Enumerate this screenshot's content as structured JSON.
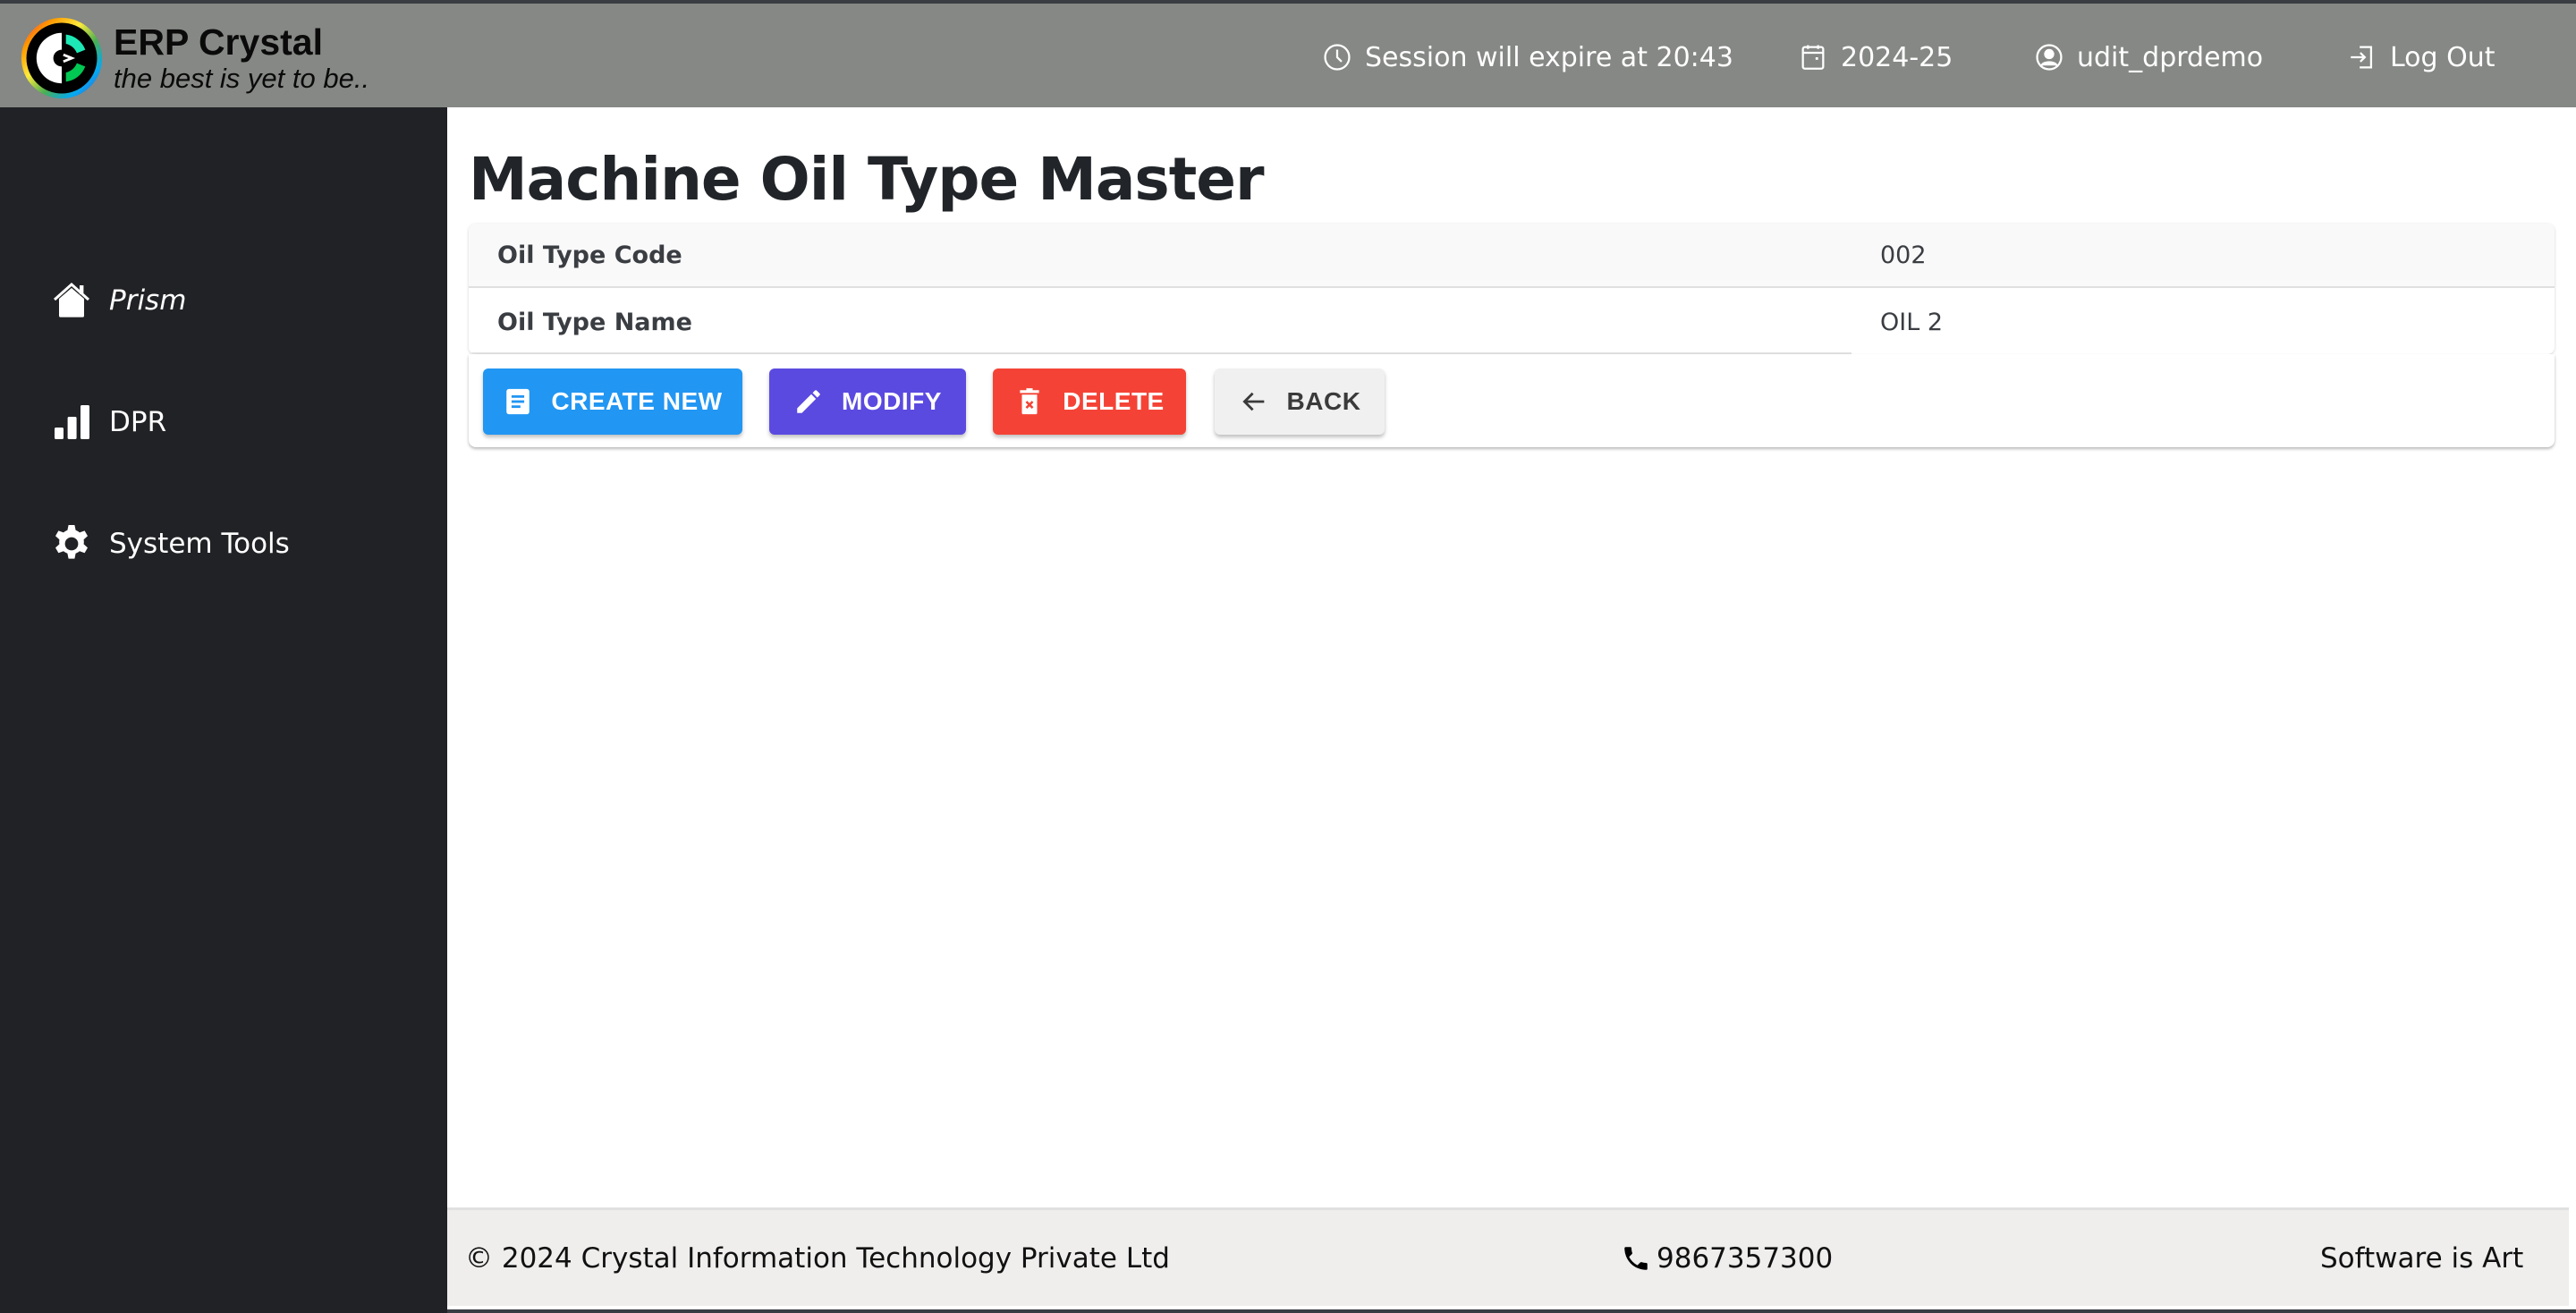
{
  "app": {
    "brand_title": "ERP Crystal",
    "brand_tagline": "the best is yet to be.."
  },
  "header": {
    "session_text": "Session will expire at 20:43",
    "financial_year": "2024-25",
    "username": "udit_dprdemo",
    "logout_label": "Log Out",
    "icons": {
      "session": "clock-icon",
      "year": "calendar-icon",
      "user": "user-circle-icon",
      "logout": "logout-icon"
    }
  },
  "sidebar": {
    "items": [
      {
        "label": "Prism",
        "icon": "home-icon"
      },
      {
        "label": "DPR",
        "icon": "bar-chart-icon"
      },
      {
        "label": "System Tools",
        "icon": "gear-icon"
      }
    ]
  },
  "main": {
    "title": "Machine Oil Type Master",
    "fields": [
      {
        "label": "Oil Type Code",
        "value": "002"
      },
      {
        "label": "Oil Type Name",
        "value": "OIL 2"
      }
    ],
    "actions": {
      "create_label": "CREATE NEW",
      "modify_label": "MODIFY",
      "delete_label": "DELETE",
      "back_label": "BACK"
    }
  },
  "footer": {
    "copyright": "© 2024 Crystal Information Technology Private Ltd",
    "phone": "9867357300",
    "tagline": "Software is Art"
  },
  "colors": {
    "header_bg": "#858884",
    "sidebar_bg": "#212225",
    "create": "#2196f3",
    "modify": "#5b4ae0",
    "delete": "#f44336",
    "back": "#f0f0f0",
    "footer_bg": "#efeeed"
  }
}
